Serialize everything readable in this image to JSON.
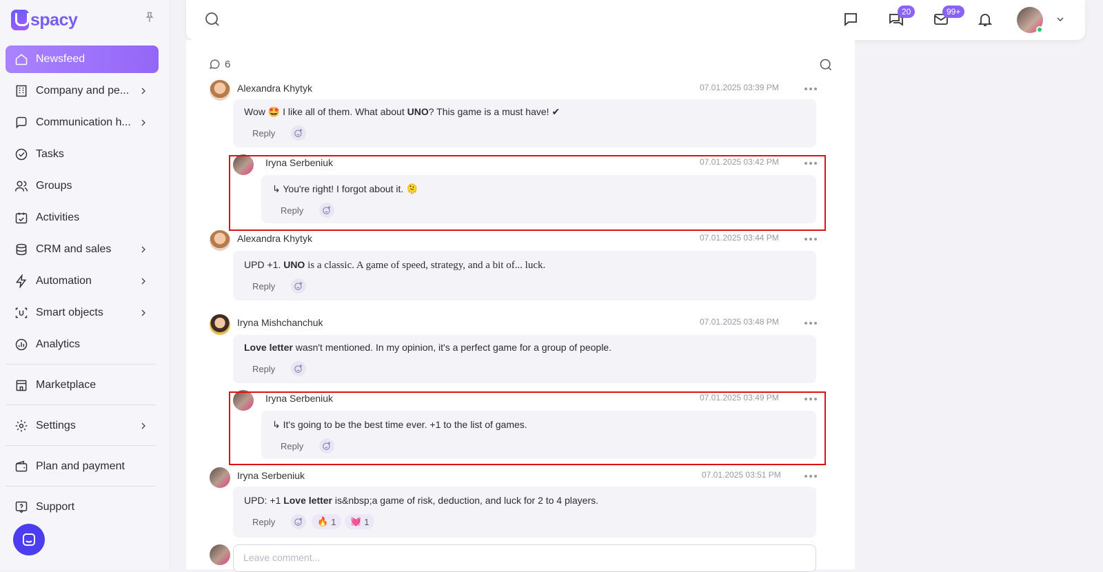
{
  "brand": {
    "name": "spacy",
    "accent": "#8a63f6"
  },
  "sidebar": {
    "items": [
      {
        "label": "Newsfeed",
        "icon": "home-icon",
        "active": true,
        "chevron": false
      },
      {
        "label": "Company and pe...",
        "icon": "building-icon",
        "chevron": true
      },
      {
        "label": "Communication h...",
        "icon": "chat-hub-icon",
        "chevron": true
      },
      {
        "label": "Tasks",
        "icon": "check-circle-icon",
        "chevron": false
      },
      {
        "label": "Groups",
        "icon": "users-icon",
        "chevron": false
      },
      {
        "label": "Activities",
        "icon": "calendar-check-icon",
        "chevron": false
      },
      {
        "label": "CRM and sales",
        "icon": "database-icon",
        "chevron": true
      },
      {
        "label": "Automation",
        "icon": "lightning-icon",
        "chevron": true
      },
      {
        "label": "Smart objects",
        "icon": "scan-face-icon",
        "chevron": true
      },
      {
        "label": "Analytics",
        "icon": "bar-chart-icon",
        "chevron": false
      }
    ],
    "bottom": [
      {
        "label": "Marketplace",
        "icon": "store-icon",
        "chevron": false
      },
      {
        "label": "Settings",
        "icon": "gear-icon",
        "chevron": true
      },
      {
        "label": "Plan and payment",
        "icon": "wallet-icon",
        "chevron": false
      },
      {
        "label": "Support",
        "icon": "help-icon",
        "chevron": false
      }
    ]
  },
  "header": {
    "chat_badge": "20",
    "mail_badge": "99+"
  },
  "comments_section": {
    "count": "6",
    "leave_placeholder": "Leave comment..."
  },
  "comments": [
    {
      "author": "Alexandra Khytyk",
      "time": "07.01.2025 03:39 PM",
      "reply": "Reply"
    },
    {
      "author": "Iryna Serbeniuk",
      "time": "07.01.2025 03:42 PM",
      "text": "You're right! I forgot about it. 🫠",
      "reply": "Reply"
    },
    {
      "author": "Alexandra Khytyk",
      "time": "07.01.2025 03:44 PM",
      "reply": "Reply"
    },
    {
      "author": "Iryna Mishchanchuk",
      "time": "07.01.2025 03:48 PM",
      "reply": "Reply"
    },
    {
      "author": "Iryna Serbeniuk",
      "time": "07.01.2025 03:49 PM",
      "text": "It's going to be the best time ever. +1 to the list of games.",
      "reply": "Reply"
    },
    {
      "author": "Iryna Serbeniuk",
      "time": "07.01.2025 03:51 PM",
      "reply": "Reply",
      "reactions": [
        {
          "emoji": "🔥",
          "count": "1"
        },
        {
          "emoji": "💓",
          "count": "1"
        }
      ]
    }
  ],
  "rich_text": {
    "c1_a": "Wow 🤩 I like all of them. What about ",
    "c1_b": "UNO",
    "c1_c": "? This game is a must have! ✔",
    "c3_a": "UPD +1. ",
    "c3_b": "UNO",
    "c3_c": " is a classic. A game of speed, strategy, and a bit of... luck.",
    "c4_a": "Love letter",
    "c4_b": " wasn't mentioned. In my opinion, it's a perfect game for a group of people.",
    "c6_a": "UPD: +1 ",
    "c6_b": "Love letter",
    "c6_c": " is&nbsp;a game of risk, deduction, and luck for 2 to 4 players."
  },
  "colors": {
    "highlight": "#e01010",
    "bubble": "#f3f3f8"
  }
}
